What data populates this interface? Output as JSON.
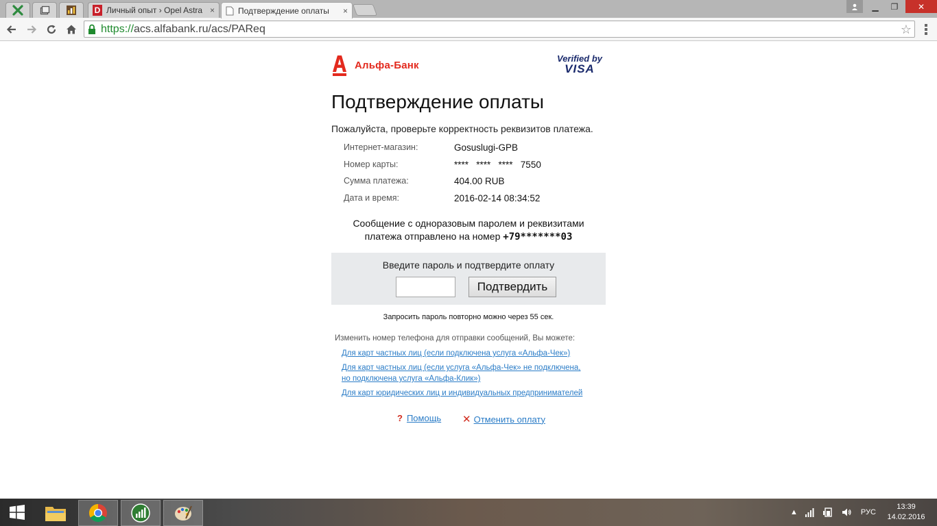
{
  "browser": {
    "tabs": [
      {
        "label": "Личный опыт › Opel Astra",
        "close": "×"
      },
      {
        "label": "Подтверждение оплаты",
        "close": "×"
      }
    ],
    "address": {
      "scheme": "https://",
      "rest": "acs.alfabank.ru/acs/PAReq"
    },
    "window": {
      "minimize": "▁",
      "maximize": "❐",
      "close": "✕"
    }
  },
  "page": {
    "bank_name": "Альфа-Банк",
    "vbv_line1": "Verified by",
    "vbv_line2": "VISA",
    "title": "Подтверждение оплаты",
    "intro": "Пожалуйста, проверьте корректность реквизитов платежа.",
    "details": [
      {
        "label": "Интернет-магазин:",
        "value": "Gosuslugi-GPB"
      },
      {
        "label": "Номер карты:",
        "value": "****   ****   ****   7550"
      },
      {
        "label": "Сумма платежа:",
        "value": "404.00 RUB"
      },
      {
        "label": "Дата и время:",
        "value": "2016-02-14 08:34:52"
      }
    ],
    "sms_line1": "Сообщение с одноразовым паролем и реквизитами",
    "sms_line2": "платежа отправлено на номер",
    "phone_masked": "+79*******03",
    "otp_label": "Введите пароль и подтвердите оплату",
    "otp_value": "",
    "confirm_button": "Подтвердить",
    "resend_note": "Запросить пароль повторно можно через 55 сек.",
    "change_phone_note": "Изменить номер телефона для отправки сообщений, Вы можете:",
    "links": [
      {
        "line1": "Для карт частных лиц (если подключена услуга «Альфа-Чек»)",
        "line2": ""
      },
      {
        "line1": "Для карт частных лиц (если услуга «Альфа-Чек» не подключена,",
        "line2": "но подключена услуга «Альфа-Клик»)"
      },
      {
        "line1": "Для карт юридических лиц и индивидуальных предпринимателей",
        "line2": ""
      }
    ],
    "help_icon": "?",
    "help_link": "Помощь",
    "cancel_icon": "✕",
    "cancel_link": "Отменить оплату"
  },
  "taskbar": {
    "lang": "РУС",
    "time": "13:39",
    "date": "14.02.2016"
  },
  "colors": {
    "brand_red": "#e32a1e",
    "link": "#2a7cc7",
    "visa_blue": "#1a2a6c"
  }
}
